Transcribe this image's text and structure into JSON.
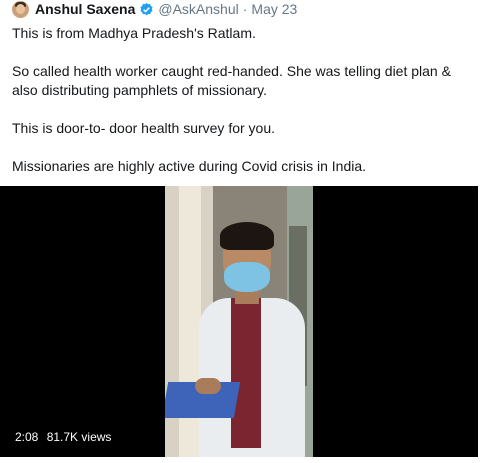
{
  "tweet": {
    "author_name": "Anshul Saxena",
    "handle": "@AskAnshul",
    "separator": "·",
    "date": "May 23",
    "avatar_icon": "user-avatar",
    "verified_icon": "verified-badge-icon",
    "verified_color": "#1da1f2",
    "paragraphs": [
      "This is from Madhya Pradesh's Ratlam.",
      "So called health worker caught red-handed. She was telling diet plan & also distributing pamphlets of missionary.",
      "This is door-to- door health survey for you.",
      "Missionaries are highly active during Covid crisis in India."
    ]
  },
  "video": {
    "duration": "2:08",
    "views": "81.7K views"
  }
}
